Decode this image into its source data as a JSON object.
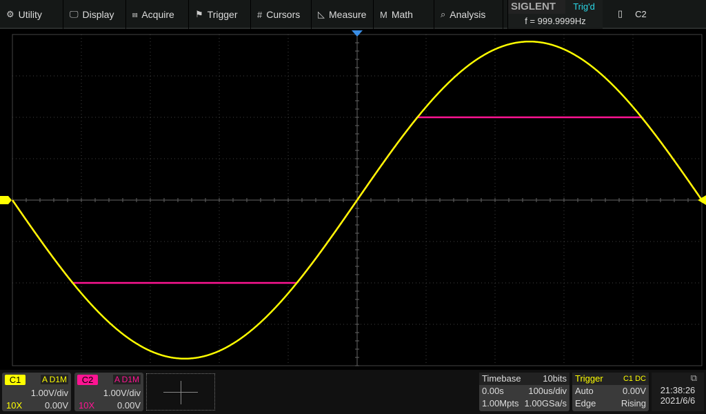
{
  "menu": [
    {
      "label": "Utility",
      "icon": "gear-icon",
      "glyph": "⚙"
    },
    {
      "label": "Display",
      "icon": "monitor-icon",
      "glyph": "🖵"
    },
    {
      "label": "Acquire",
      "icon": "acquire-icon",
      "glyph": "⩎"
    },
    {
      "label": "Trigger",
      "icon": "flag-icon",
      "glyph": "⚑"
    },
    {
      "label": "Cursors",
      "icon": "cursors-icon",
      "glyph": "#"
    },
    {
      "label": "Measure",
      "icon": "ruler-triangle-icon",
      "glyph": "◺"
    },
    {
      "label": "Math",
      "icon": "math-icon",
      "glyph": "M"
    },
    {
      "label": "Analysis",
      "icon": "analysis-icon",
      "glyph": "⌕"
    }
  ],
  "brand": {
    "logo": "SIGLENT",
    "trig_status": "Trig'd",
    "frequency": "f = 999.9999Hz"
  },
  "channel_select": {
    "icon": "battery-icon",
    "label": "C2"
  },
  "colors": {
    "c1": "#ffff00",
    "c2": "#ff1493",
    "grid": "#444444",
    "trigger_marker": "#3a8ee6"
  },
  "channels": [
    {
      "tag": "C1",
      "coupling": "A D1M",
      "vdiv": "1.00V/div",
      "probe": "10X",
      "offset": "0.00V",
      "color": "#ffff00"
    },
    {
      "tag": "C2",
      "coupling": "A D1M",
      "vdiv": "1.00V/div",
      "probe": "10X",
      "offset": "0.00V",
      "color": "#ff1493"
    }
  ],
  "timebase": {
    "title": "Timebase",
    "bits": "10bits",
    "delay": "0.00s",
    "tdiv": "100us/div",
    "mem": "1.00Mpts",
    "srate": "1.00GSa/s"
  },
  "trigger": {
    "title": "Trigger",
    "source": "C1",
    "coupling": "DC",
    "mode": "Auto",
    "level": "0.00V",
    "type": "Edge",
    "slope": "Rising"
  },
  "clock": {
    "time": "21:38:26",
    "date": "2021/6/6",
    "icon": "network-icon"
  },
  "waveforms": {
    "c1": {
      "type": "sine",
      "amplitude_v": 3.83,
      "frequency_hz": 1000,
      "phase": "inverted"
    },
    "c2": {
      "type": "clipped-sine",
      "amplitude_v": 3.83,
      "clip_v": 2.0
    }
  }
}
